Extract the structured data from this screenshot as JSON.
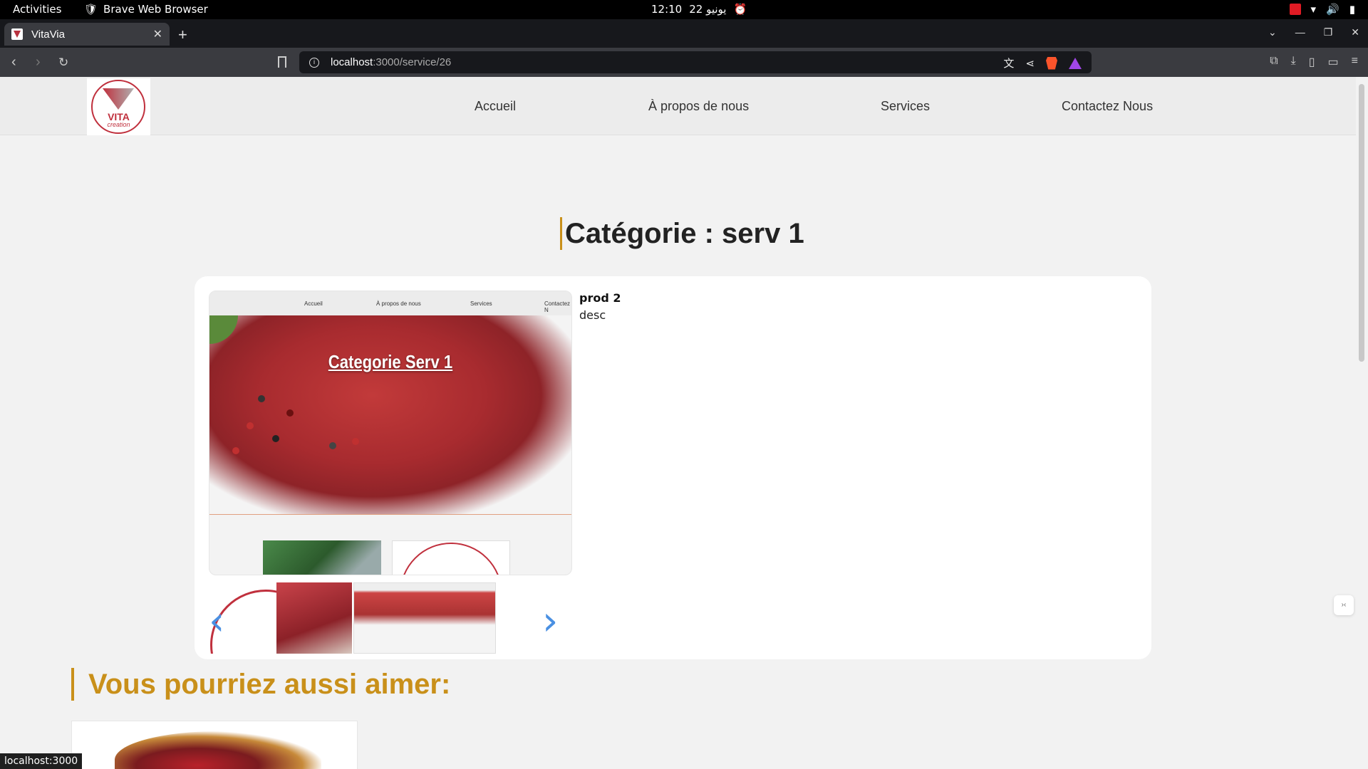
{
  "system_bar": {
    "activities": "Activities",
    "app_name": "Brave Web Browser",
    "time": "12:10",
    "date": "22 يونيو"
  },
  "browser": {
    "tab_title": "VitaVia",
    "new_tab": "+",
    "url_host": "localhost",
    "url_path": ":3000/service/26",
    "status_link": "localhost:3000"
  },
  "site": {
    "logo_word": "VITA",
    "logo_sub": "creation",
    "nav": [
      {
        "label": "Accueil"
      },
      {
        "label": "À propos de nous"
      },
      {
        "label": "Services"
      },
      {
        "label": "Contactez Nous"
      }
    ],
    "category_title": "Catégorie : serv 1",
    "product": {
      "name": "prod 2",
      "description": "desc",
      "image_caption": "Categorie Serv 1",
      "mini_nav": [
        "Accueil",
        "À propos de nous",
        "Services",
        "Contactez N"
      ]
    },
    "carousel": {
      "prev_arrow": "‹",
      "next_arrow": "›"
    },
    "recommend_title": "Vous pourriez aussi aimer:"
  },
  "colors": {
    "accent_gold": "#c9901a",
    "brand_red": "#c0303d",
    "arrow_blue": "#4a90e2"
  }
}
